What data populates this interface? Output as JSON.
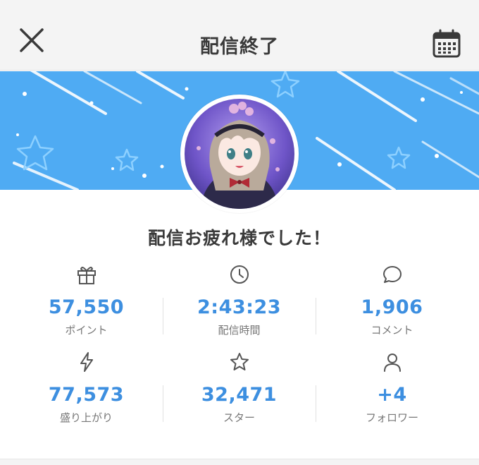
{
  "header": {
    "title": "配信終了",
    "close_icon": "close-icon",
    "calendar_icon": "calendar-icon"
  },
  "banner": {
    "color": "#4fabf3",
    "decor": "stars-and-streaks"
  },
  "avatar": {
    "icon": "avatar-image"
  },
  "message": "配信お疲れ様でした！",
  "colors": {
    "accent": "#3d8fe0",
    "label": "#777777"
  },
  "stats": [
    {
      "icon": "gift-icon",
      "value": "57,550",
      "label": "ポイント"
    },
    {
      "icon": "clock-icon",
      "value": "2:43:23",
      "label": "配信時間"
    },
    {
      "icon": "comment-icon",
      "value": "1,906",
      "label": "コメント"
    },
    {
      "icon": "lightning-icon",
      "value": "77,573",
      "label": "盛り上がり"
    },
    {
      "icon": "star-icon",
      "value": "32,471",
      "label": "スター"
    },
    {
      "icon": "person-icon",
      "value": "+4",
      "label": "フォロワー"
    }
  ]
}
